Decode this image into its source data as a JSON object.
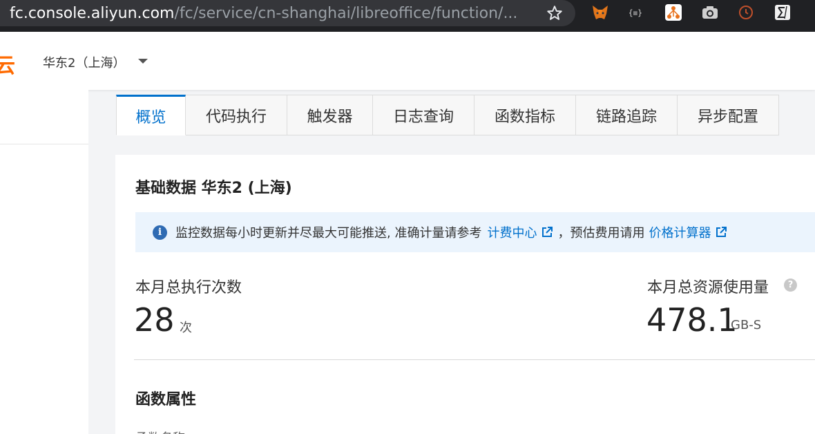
{
  "browser": {
    "url_host": "fc.console.aliyun.com",
    "url_path": "/fc/service/cn-shanghai/libreoffice/function/..."
  },
  "header": {
    "logo_fragment": "云",
    "region": "华东2（上海）"
  },
  "tabs": [
    {
      "label": "概览",
      "active": true
    },
    {
      "label": "代码执行",
      "active": false
    },
    {
      "label": "触发器",
      "active": false
    },
    {
      "label": "日志查询",
      "active": false
    },
    {
      "label": "函数指标",
      "active": false
    },
    {
      "label": "链路追踪",
      "active": false
    },
    {
      "label": "异步配置",
      "active": false
    }
  ],
  "panel": {
    "title": "基础数据 华东2 (上海)",
    "banner": {
      "text": "监控数据每小时更新并尽最大可能推送, 准确计量请参考",
      "link1": "计费中心",
      "separator": "，预估费用请用",
      "link2": "价格计算器"
    },
    "stats": {
      "executions": {
        "label": "本月总执行次数",
        "value": "28",
        "unit": "次"
      },
      "resource": {
        "label": "本月总资源使用量",
        "value": "478.1",
        "unit": "GB-S"
      }
    },
    "section_title": "函数属性",
    "cut_text": "函数名称"
  },
  "colors": {
    "accent": "#0070cc",
    "brand": "#ff6a00",
    "banner_bg": "#ebf4fd"
  }
}
